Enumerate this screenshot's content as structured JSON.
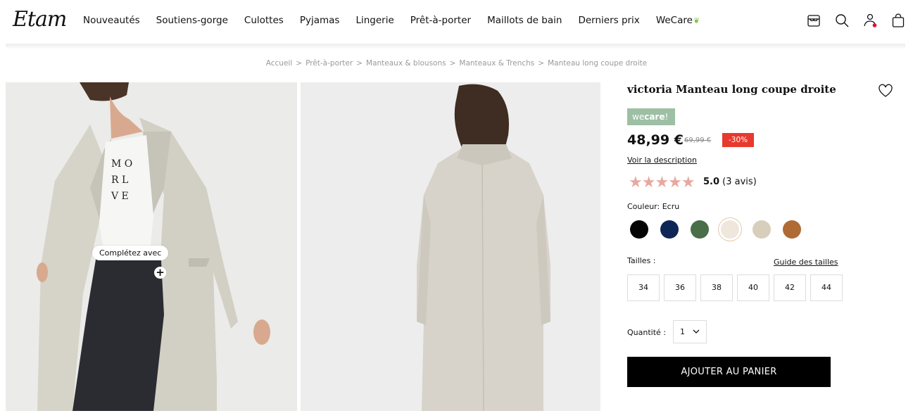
{
  "header": {
    "logo": "Etam",
    "nav": [
      {
        "label": "Nouveautés"
      },
      {
        "label": "Soutiens-gorge"
      },
      {
        "label": "Culottes"
      },
      {
        "label": "Pyjamas"
      },
      {
        "label": "Lingerie"
      },
      {
        "label": "Prêt-à-porter"
      },
      {
        "label": "Maillots de bain"
      },
      {
        "label": "Derniers prix"
      },
      {
        "label": "WeCare"
      }
    ],
    "icons": [
      "store-icon",
      "search-icon",
      "account-icon",
      "bag-icon"
    ]
  },
  "breadcrumb": [
    "Accueil",
    "Prêt-à-porter",
    "Manteaux & blousons",
    "Manteaux & Trenchs",
    "Manteau long coupe droite"
  ],
  "breadcrumb_sep": ">",
  "gallery": {
    "complete_tag": "Complétez avec",
    "tshirt_text": [
      "M O",
      "R L",
      "V E"
    ]
  },
  "product": {
    "title": "victoria Manteau long coupe droite",
    "badge": {
      "prefix": "we",
      "bold": "care",
      "suffix": "!"
    },
    "price": "48,99 €",
    "old_price": "69,99 €",
    "discount": "-30%",
    "description_link": "Voir la description",
    "stars": "★★★★★",
    "rating_score": "5.0",
    "rating_count": "(3 avis)",
    "color_label": "Couleur: Ecru",
    "colors": [
      {
        "name": "noir",
        "hex": "#050505"
      },
      {
        "name": "marine",
        "hex": "#0d2656"
      },
      {
        "name": "vert",
        "hex": "#486f47"
      },
      {
        "name": "ecru",
        "hex": "#efe6dc",
        "selected": true
      },
      {
        "name": "beige",
        "hex": "#d8cebc"
      },
      {
        "name": "camel",
        "hex": "#b06a33"
      }
    ],
    "sizes_label": "Tailles :",
    "size_guide": "Guide des tailles",
    "sizes": [
      "34",
      "36",
      "38",
      "40",
      "42",
      "44"
    ],
    "quantity_label": "Quantité :",
    "quantity_value": "1",
    "add_to_cart": "AJOUTER AU PANIER"
  },
  "colors": {
    "discount_red": "#e8392e",
    "star_pink": "#e8a8a0",
    "wecare_green": "#9dbfa4"
  }
}
